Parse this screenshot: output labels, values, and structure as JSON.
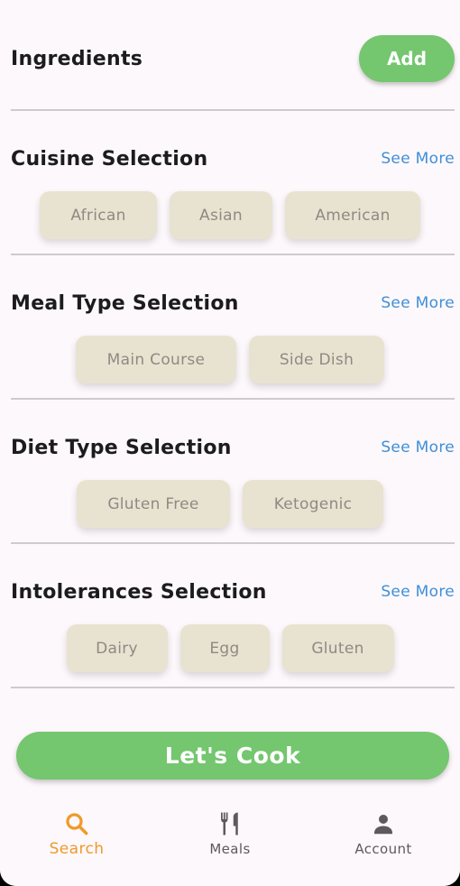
{
  "header": {
    "title": "Ingredients",
    "add_label": "Add"
  },
  "sections": [
    {
      "title": "Cuisine Selection",
      "see_more": "See More",
      "chips": [
        "African",
        "Asian",
        "American"
      ]
    },
    {
      "title": "Meal Type Selection",
      "see_more": "See More",
      "chips": [
        "Main Course",
        "Side Dish"
      ]
    },
    {
      "title": "Diet Type Selection",
      "see_more": "See More",
      "chips": [
        "Gluten Free",
        "Ketogenic"
      ]
    },
    {
      "title": "Intolerances Selection",
      "see_more": "See More",
      "chips": [
        "Dairy",
        "Egg",
        "Gluten"
      ]
    }
  ],
  "cook_label": "Let's Cook",
  "nav": [
    {
      "label": "Search",
      "icon": "search-icon",
      "active": true
    },
    {
      "label": "Meals",
      "icon": "fork-knife-icon",
      "active": false
    },
    {
      "label": "Account",
      "icon": "person-icon",
      "active": false
    }
  ],
  "colors": {
    "accent_green": "#74c66f",
    "link_blue": "#3f8fd8",
    "chip_bg": "#e8e3d0",
    "nav_active": "#ef9a2a"
  }
}
